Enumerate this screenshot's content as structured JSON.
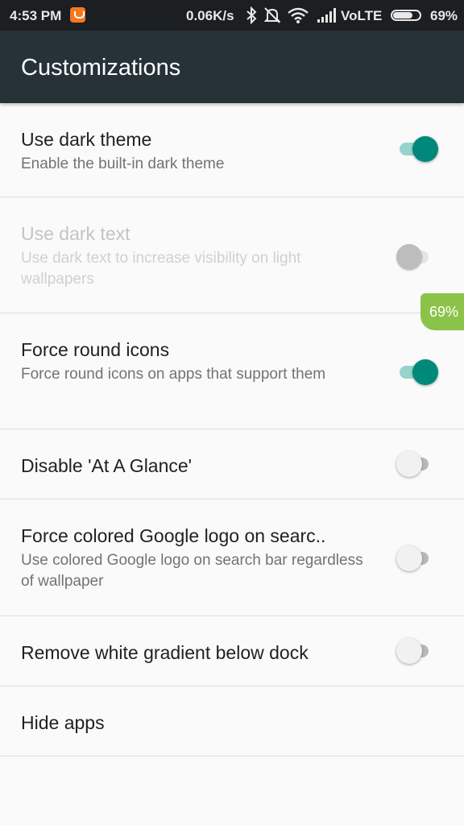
{
  "status_bar": {
    "time": "4:53 PM",
    "net_speed": "0.06K/s",
    "network": "VoLTE",
    "battery": "69%",
    "icons": [
      "notification-app-icon",
      "bluetooth-icon",
      "alarm-off-icon",
      "wifi-icon",
      "signal-icon",
      "battery-icon"
    ]
  },
  "app_bar": {
    "title": "Customizations"
  },
  "settings": [
    {
      "title": "Use dark theme",
      "summary": "Enable the built-in dark theme",
      "checked": true,
      "enabled": true
    },
    {
      "title": "Use dark text",
      "summary": "Use dark text to increase visibility on light wallpapers",
      "checked": false,
      "enabled": false
    },
    {
      "title": "Force round icons",
      "summary": "Force round icons on apps that support them",
      "checked": true,
      "enabled": true
    },
    {
      "title": "Disable 'At A Glance'",
      "summary": "",
      "checked": false,
      "enabled": true
    },
    {
      "title": "Force colored Google logo on searc..",
      "summary": "Use colored Google logo on search bar regardless of wallpaper",
      "checked": false,
      "enabled": true
    },
    {
      "title": "Remove white gradient below dock",
      "summary": "",
      "checked": false,
      "enabled": true
    },
    {
      "title": "Hide apps",
      "summary": ""
    }
  ],
  "battery_overlay": {
    "label": "69%"
  },
  "colors": {
    "accent": "#00897b",
    "app_bar": "#263238",
    "status_bar": "#1c1f22",
    "battery_overlay": "#8bc34a"
  }
}
